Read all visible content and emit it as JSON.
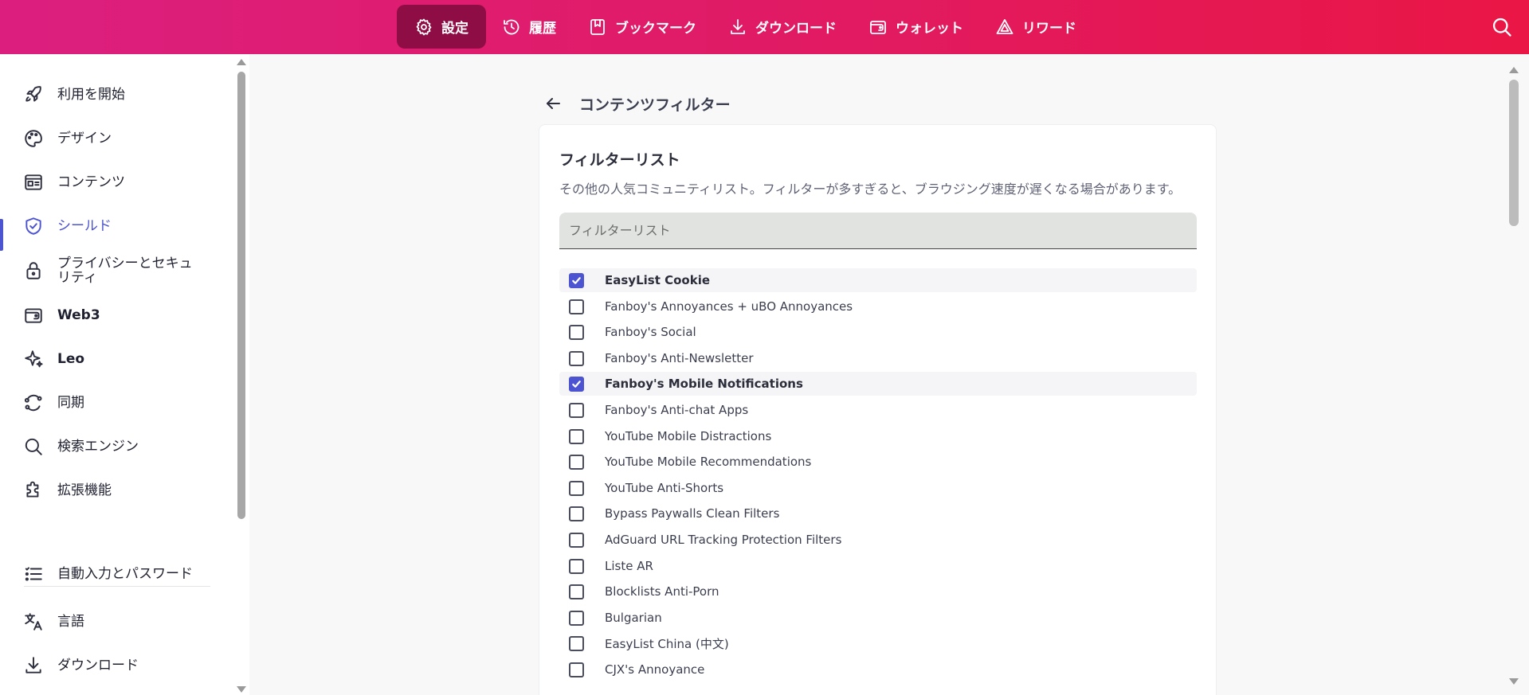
{
  "topnav": {
    "tabs": [
      {
        "label": "設定",
        "icon": "gear-icon",
        "active": true
      },
      {
        "label": "履歴",
        "icon": "history-icon",
        "active": false
      },
      {
        "label": "ブックマーク",
        "icon": "bookmark-icon",
        "active": false
      },
      {
        "label": "ダウンロード",
        "icon": "download-icon",
        "active": false
      },
      {
        "label": "ウォレット",
        "icon": "wallet-icon",
        "active": false
      },
      {
        "label": "リワード",
        "icon": "rewards-triangle-icon",
        "active": false
      }
    ],
    "search_icon": "search-icon",
    "gradient_colors": [
      "#dc1f7f",
      "#ea1645"
    ],
    "active_tab_color": "#8f0d45"
  },
  "sidebar": {
    "items": [
      {
        "label": "利用を開始",
        "icon": "rocket-icon",
        "active": false
      },
      {
        "label": "デザイン",
        "icon": "palette-icon",
        "active": false
      },
      {
        "label": "コンテンツ",
        "icon": "content-icon",
        "active": false
      },
      {
        "label": "シールド",
        "icon": "shield-icon",
        "active": true
      },
      {
        "label": "プライバシーとセキュリティ",
        "icon": "lock-icon",
        "active": false
      },
      {
        "label": "Web3",
        "icon": "wallet-icon",
        "active": false
      },
      {
        "label": "Leo",
        "icon": "sparkle-icon",
        "active": false
      },
      {
        "label": "同期",
        "icon": "sync-icon",
        "active": false
      },
      {
        "label": "検索エンジン",
        "icon": "search-icon",
        "active": false
      },
      {
        "label": "拡張機能",
        "icon": "puzzle-icon",
        "active": false
      },
      {
        "label": "自動入力とパスワード",
        "icon": "list-icon",
        "active": false
      },
      {
        "label": "言語",
        "icon": "translate-icon",
        "active": false
      },
      {
        "label": "ダウンロード",
        "icon": "download-icon",
        "active": false
      }
    ],
    "accent_color": "#4c54d2"
  },
  "page": {
    "title": "コンテンツフィルター"
  },
  "card": {
    "title": "フィルターリスト",
    "description": "その他の人気コミュニティリスト。フィルターが多すぎると、ブラウジング速度が遅くなる場合があります。",
    "filter_placeholder": "フィルターリスト",
    "filter_value": "",
    "items": [
      {
        "label": "EasyList Cookie",
        "checked": true
      },
      {
        "label": "Fanboy's Annoyances + uBO Annoyances",
        "checked": false
      },
      {
        "label": "Fanboy's Social",
        "checked": false
      },
      {
        "label": "Fanboy's Anti-Newsletter",
        "checked": false
      },
      {
        "label": "Fanboy's Mobile Notifications",
        "checked": true
      },
      {
        "label": "Fanboy's Anti-chat Apps",
        "checked": false
      },
      {
        "label": "YouTube Mobile Distractions",
        "checked": false
      },
      {
        "label": "YouTube Mobile Recommendations",
        "checked": false
      },
      {
        "label": "YouTube Anti-Shorts",
        "checked": false
      },
      {
        "label": "Bypass Paywalls Clean Filters",
        "checked": false
      },
      {
        "label": "AdGuard URL Tracking Protection Filters",
        "checked": false
      },
      {
        "label": "Liste AR",
        "checked": false
      },
      {
        "label": "Blocklists Anti-Porn",
        "checked": false
      },
      {
        "label": "Bulgarian",
        "checked": false
      },
      {
        "label": "EasyList China (中文)",
        "checked": false
      },
      {
        "label": "CJX's Annoyance",
        "checked": false
      }
    ]
  }
}
